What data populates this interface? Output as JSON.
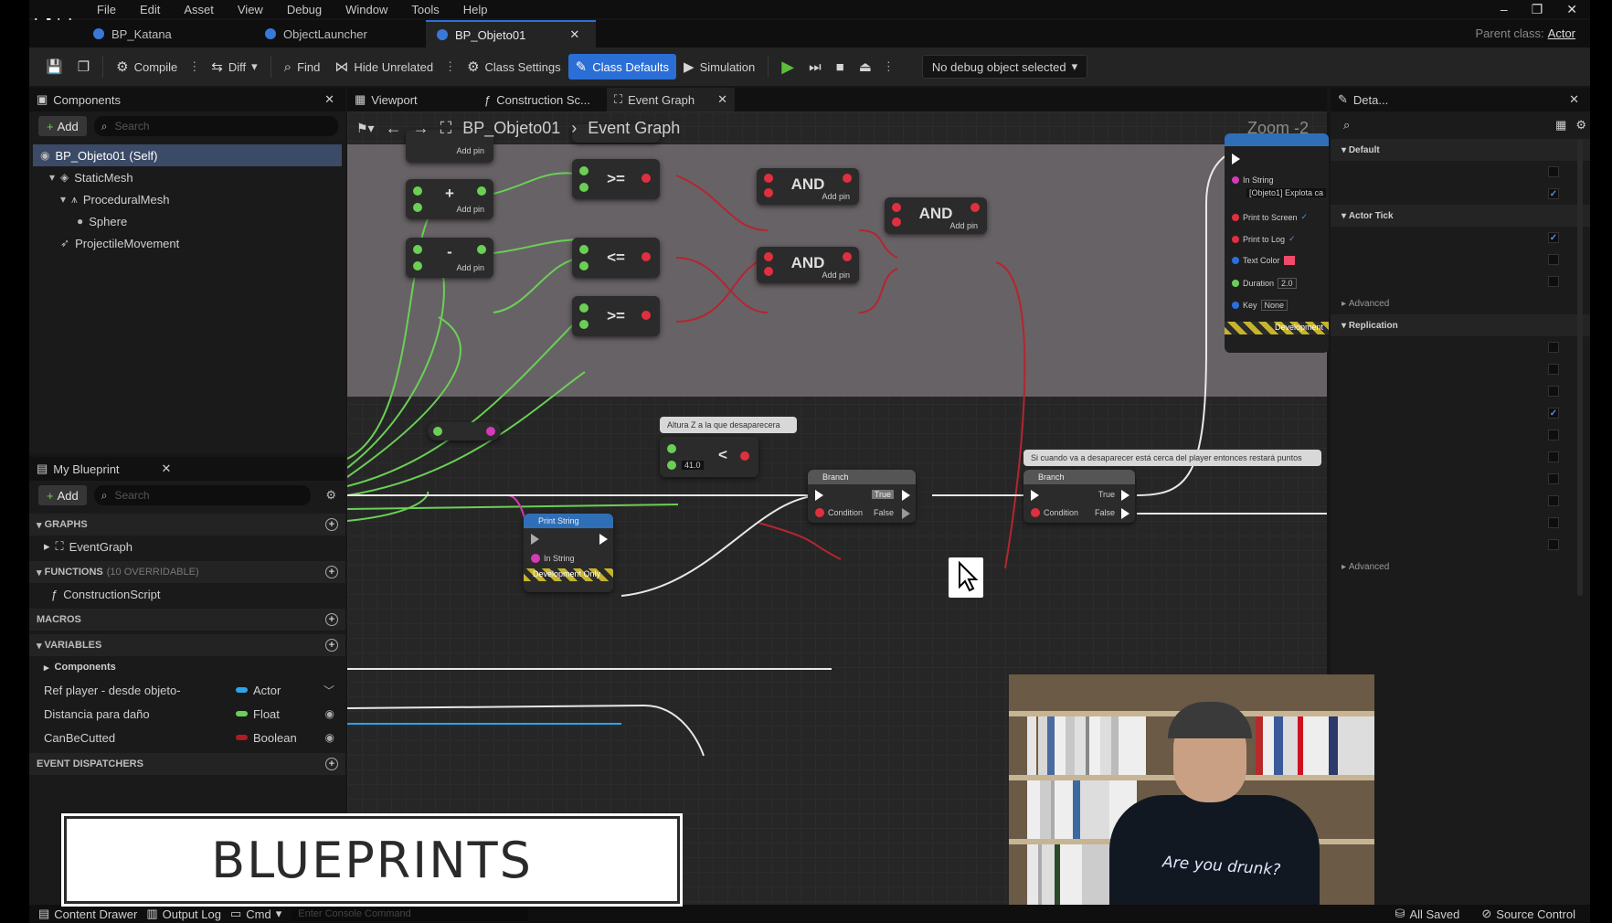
{
  "menu": [
    "File",
    "Edit",
    "Asset",
    "View",
    "Debug",
    "Window",
    "Tools",
    "Help"
  ],
  "doc_tabs": [
    {
      "label": "BP_Katana"
    },
    {
      "label": "ObjectLauncher"
    },
    {
      "label": "BP_Objeto01",
      "active": true
    }
  ],
  "parent_class": {
    "label": "Parent class:",
    "value": "Actor"
  },
  "toolbar": {
    "compile": "Compile",
    "diff": "Diff",
    "find": "Find",
    "hide_unrelated": "Hide Unrelated",
    "class_settings": "Class Settings",
    "class_defaults": "Class Defaults",
    "simulation": "Simulation",
    "debug_object": "No debug object selected"
  },
  "components_panel": {
    "title": "Components",
    "add": "Add",
    "search_placeholder": "Search",
    "tree": [
      {
        "label": "BP_Objeto01 (Self)",
        "depth": 0,
        "selected": true
      },
      {
        "label": "StaticMesh",
        "depth": 1
      },
      {
        "label": "ProceduralMesh",
        "depth": 2
      },
      {
        "label": "Sphere",
        "depth": 3
      },
      {
        "label": "ProjectileMovement",
        "depth": 1
      }
    ]
  },
  "my_blueprint": {
    "title": "My Blueprint",
    "add": "Add",
    "search_placeholder": "Search",
    "graphs_header": "GRAPHS",
    "graphs": [
      "EventGraph"
    ],
    "functions_header": "FUNCTIONS",
    "functions_note": "(10 OVERRIDABLE)",
    "functions": [
      "ConstructionScript"
    ],
    "macros_header": "MACROS",
    "variables_header": "VARIABLES",
    "components_group": "Components",
    "variables": [
      {
        "name": "Ref player - desde objeto-",
        "type": "Actor",
        "color": "#2fa3e8"
      },
      {
        "name": "Distancia para daño",
        "type": "Float",
        "color": "#6ad055"
      },
      {
        "name": "CanBeCutted",
        "type": "Boolean",
        "color": "#b01b22"
      }
    ],
    "dispatchers_header": "EVENT DISPATCHERS"
  },
  "graph_tabs": [
    "Viewport",
    "Construction Sc...",
    "Event Graph"
  ],
  "graph": {
    "breadcrumb_root": "BP_Objeto01",
    "breadcrumb_leaf": "Event Graph",
    "zoom": "Zoom -2",
    "add_pin": "Add pin",
    "op_plus": "+",
    "op_minus": "-",
    "op_ge": ">=",
    "op_le": "<=",
    "op_and": "AND",
    "op_lt": "<",
    "lt_value": "41.0",
    "comment_1": "Altura Z a la que desaparecera",
    "comment_2": "Si cuando va a desaparecer está cerca del player entonces restará puntos",
    "print_string_title": "Print String",
    "in_string": "In String",
    "dev_only": "Development Only",
    "branch_title": "Branch",
    "condition": "Condition",
    "true_label": "True",
    "false_label": "False",
    "ps_in_string": "In String",
    "ps_value": "[Objeto1] Explota ca",
    "ps_print_screen": "Print to Screen",
    "ps_print_log": "Print to Log",
    "ps_text_color": "Text Color",
    "ps_duration": "Duration",
    "ps_duration_val": "2.0",
    "ps_key": "Key",
    "ps_key_val": "None",
    "ps_dev": "Development"
  },
  "details": {
    "title": "Deta...",
    "sections": [
      "Default",
      "Actor Tick",
      "Advanced",
      "Replication",
      "Advanced"
    ]
  },
  "banner": "BLUEPRINTS",
  "webcam_shirt": "Are you drunk?",
  "statusbar": {
    "content_drawer": "Content Drawer",
    "output_log": "Output Log",
    "cmd": "Cmd",
    "console_placeholder": "Enter Console Command",
    "all_saved": "All Saved",
    "source_control": "Source Control"
  }
}
